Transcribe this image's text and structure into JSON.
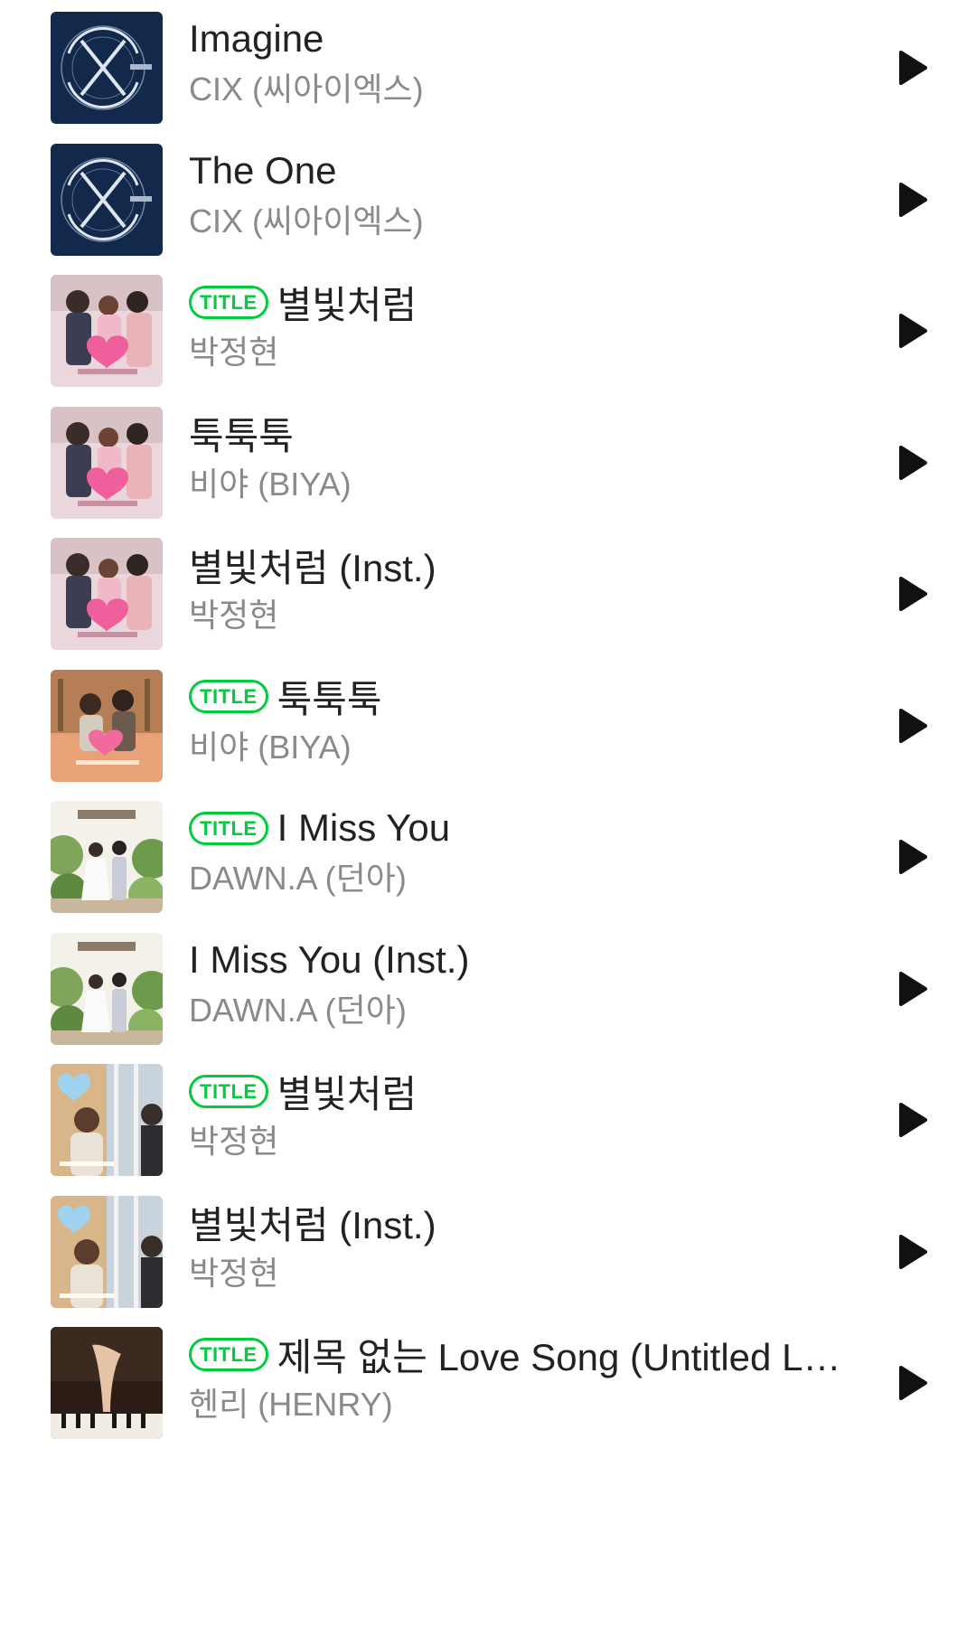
{
  "colors": {
    "accent": "#00cd3c",
    "title_text": "#222222",
    "artist_text": "#8a8a8a",
    "play_icon": "#111111"
  },
  "songs": [
    {
      "title": "Imagine",
      "artist": "CIX (씨아이엑스)",
      "badge": "",
      "art": "cix"
    },
    {
      "title": "The One",
      "artist": "CIX (씨아이엑스)",
      "badge": "",
      "art": "cix"
    },
    {
      "title": "별빛처럼",
      "artist": "박정현",
      "badge": "TITLE",
      "art": "drama-pink"
    },
    {
      "title": "툭툭툭",
      "artist": "비야 (BIYA)",
      "badge": "",
      "art": "drama-pink"
    },
    {
      "title": "별빛처럼 (Inst.)",
      "artist": "박정현",
      "badge": "",
      "art": "drama-pink"
    },
    {
      "title": "툭툭툭",
      "artist": "비야 (BIYA)",
      "badge": "TITLE",
      "art": "drama-orange"
    },
    {
      "title": "I Miss You",
      "artist": "DAWN.A (던아)",
      "badge": "TITLE",
      "art": "garden"
    },
    {
      "title": "I Miss You (Inst.)",
      "artist": "DAWN.A (던아)",
      "badge": "",
      "art": "garden"
    },
    {
      "title": "별빛처럼",
      "artist": "박정현",
      "badge": "TITLE",
      "art": "window"
    },
    {
      "title": "별빛처럼 (Inst.)",
      "artist": "박정현",
      "badge": "",
      "art": "window"
    },
    {
      "title": "제목 없는 Love Song (Untitled Lov…",
      "artist": "헨리 (HENRY)",
      "badge": "TITLE",
      "art": "piano"
    }
  ]
}
